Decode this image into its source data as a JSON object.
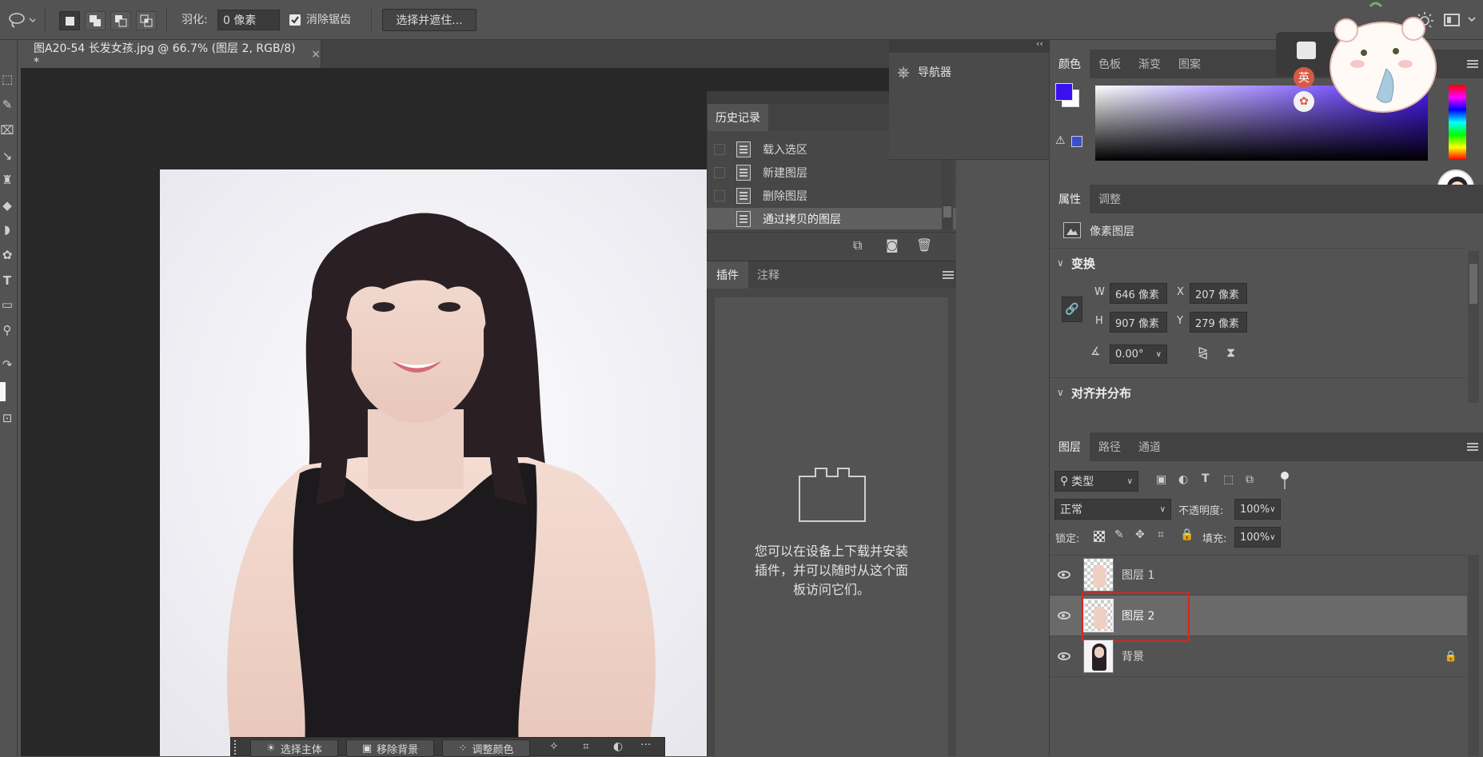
{
  "options_bar": {
    "feather_label": "羽化:",
    "feather_value": "0 像素",
    "antialias_label": "消除锯齿",
    "select_mask_button": "选择并遮住..."
  },
  "document": {
    "tab_title": "图A20-54 长发女孩.jpg @ 66.7% (图层 2, RGB/8) *"
  },
  "navigator": {
    "label": "导航器"
  },
  "history_panel": {
    "title": "历史记录",
    "items": [
      "载入选区",
      "新建图层",
      "删除图层",
      "通过拷贝的图层"
    ]
  },
  "plugins_panel": {
    "tabs": [
      "插件",
      "注释"
    ],
    "message_line1": "您可以在设备上下载并安装",
    "message_line2": "插件，并可以随时从这个面",
    "message_line3": "板访问它们。"
  },
  "color_panel": {
    "tabs": [
      "颜色",
      "色板",
      "渐变",
      "图案"
    ],
    "foreground_color": "#3a10f0",
    "background_color": "#ffffff"
  },
  "properties_panel": {
    "tabs": [
      "属性",
      "调整"
    ],
    "layer_type": "像素图层",
    "transform_section": "变换",
    "w_label": "W",
    "w_value": "646 像素",
    "x_label": "X",
    "x_value": "207 像素",
    "h_label": "H",
    "h_value": "907 像素",
    "y_label": "Y",
    "y_value": "279 像素",
    "angle_value": "0.00°",
    "align_section": "对齐并分布"
  },
  "layers_panel": {
    "tabs": [
      "图层",
      "路径",
      "通道"
    ],
    "filter_kind": "类型",
    "blend_mode": "正常",
    "opacity_label": "不透明度:",
    "opacity_value": "100%",
    "lock_label": "锁定:",
    "fill_label": "填充:",
    "fill_value": "100%",
    "layers": [
      "图层 1",
      "图层 2",
      "背景"
    ]
  },
  "context_bar": {
    "select_subject": "选择主体",
    "remove_background": "移除背景",
    "adjust_color": "调整颜色"
  },
  "ime": {
    "mode": "英"
  }
}
